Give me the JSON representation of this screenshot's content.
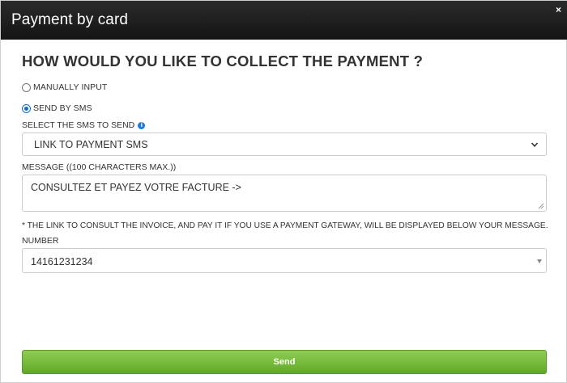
{
  "modal": {
    "title": "Payment by card",
    "close_glyph": "×"
  },
  "form": {
    "heading": "HOW WOULD YOU LIKE TO COLLECT THE PAYMENT ?",
    "options": [
      {
        "label": "MANUALLY INPUT",
        "checked": false
      },
      {
        "label": "SEND BY SMS",
        "checked": true
      }
    ],
    "sms_label": "SELECT THE SMS TO SEND",
    "info_glyph": "i",
    "sms_selected": "LINK TO PAYMENT SMS",
    "message_label": "MESSAGE ((100 CHARACTERS MAX.))",
    "message_value": "CONSULTEZ ET PAYEZ VOTRE FACTURE ->",
    "note": "* THE LINK TO CONSULT THE INVOICE, AND PAY IT IF YOU USE A PAYMENT GATEWAY, WILL BE DISPLAYED BELOW YOUR MESSAGE.",
    "number_label": "NUMBER",
    "number_value": "14161231234",
    "send_label": "Send"
  },
  "icons": {
    "close": "close-icon",
    "info": "info-icon",
    "select_chevron": "chevron-down-icon",
    "number_caret": "caret-down-icon",
    "resize": "resize-grip-icon"
  },
  "colors": {
    "titlebar": "#1e1e1e",
    "send_button": "#72b83a",
    "radio_accent": "#0b6cd8",
    "info_icon": "#1e7bd6"
  }
}
